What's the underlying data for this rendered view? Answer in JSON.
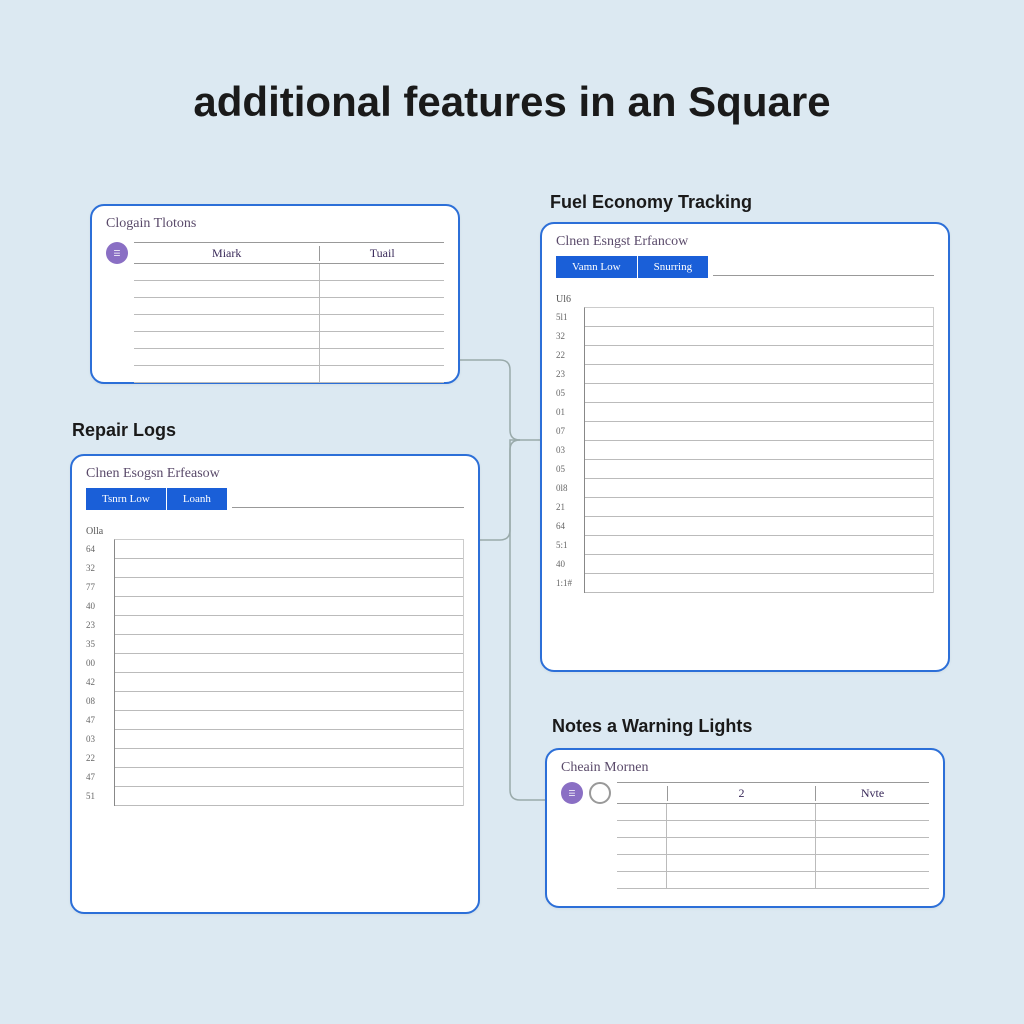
{
  "title": "additional features in an Square",
  "sections": {
    "repair": "Repair Logs",
    "fuel": "Fuel Economy Tracking",
    "notes": "Notes a Warning Lights"
  },
  "card1": {
    "title": "Clogain Tlotons",
    "headers": [
      "Miark",
      "Tuail"
    ],
    "row_count": 7
  },
  "card2": {
    "title": "Clnen Esogsn Erfeasow",
    "tabs": [
      "Tsnrn Low",
      "Loanh"
    ],
    "axis_top": "Olla",
    "axis_values": [
      "64",
      "32",
      "77",
      "40",
      "23",
      "35",
      "00",
      "42",
      "08",
      "47",
      "03",
      "22",
      "47",
      "51"
    ]
  },
  "card3": {
    "title": "Clnen Esngst Erfancow",
    "tabs": [
      "Vamn Low",
      "Snurring"
    ],
    "axis_top": "Ul6",
    "axis_values": [
      "5l1",
      "32",
      "22",
      "23",
      "05",
      "01",
      "07",
      "03",
      "05",
      "0l8",
      "21",
      "64",
      "5:1",
      "40",
      "1:1#"
    ]
  },
  "card4": {
    "title": "Cheain Mornen",
    "headers": [
      "",
      "2",
      "Nvte"
    ],
    "row_count": 5
  }
}
